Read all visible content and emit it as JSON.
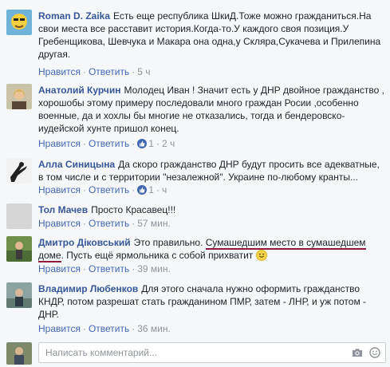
{
  "comments": [
    {
      "author": "Roman D. Zaika",
      "text": "Есть еще республика ШкиД.Тоже можно гражданиться.На свои места все расставит история.Когда-то.У каждого своя позиция.У Гребенщикова, Шевчука и Макара она одна,у Скляра,Сукачева и Прилепина другая.",
      "like": "Нравится",
      "reply": "Ответить",
      "time": "5 ч"
    },
    {
      "author": "Анатолий Курчин",
      "text": "Молодец Иван ! Значит есть у ДНР двойное гражданство , хорошобы этому примеру последовали много граждан Росии ,особенно военные, да и хохлы бы многие не отказались, тогда и бендеровско-иудейской хунте пришол конец.",
      "like": "Нравится",
      "reply": "Ответить",
      "likes": "1",
      "time": "2 ч"
    },
    {
      "author": "Алла Синицына",
      "text": "Да скоро гражданство ДНР будут просить все адекватные, в том числе и с территории \"незалежной\". Украине по-любому кранты...",
      "like": "Нравится",
      "reply": "Ответить",
      "likes": "1",
      "time": "ч"
    },
    {
      "author": "Тол Мачев",
      "text": "Просто Красавец!!!",
      "like": "Нравится",
      "reply": "Ответить",
      "time": "57 мин."
    },
    {
      "author": "Дмитро Діковський",
      "text_a": "Это правильно. ",
      "text_ul1": "Сумашедшим место в сумашедшем",
      "text_ul2": "доме",
      "text_b": ". Пусть ещё ярмольника с собой прихватит",
      "like": "Нравится",
      "reply": "Ответить",
      "time": "39 мин."
    },
    {
      "author": "Владимир Любенков",
      "text": "Для этого сначала нужно оформить гражданство КНДР, потом разрешат стать гражданином ПМР, затем - ЛНР, и уж потом - ДНР.",
      "like": "Нравится",
      "reply": "Ответить",
      "time": "36 мин."
    }
  ],
  "compose": {
    "placeholder": "Написать комментарий..."
  },
  "colors": {
    "author": "#365899",
    "link": "#4267b2",
    "meta": "#90949c",
    "underline": "#8e1b3a"
  }
}
